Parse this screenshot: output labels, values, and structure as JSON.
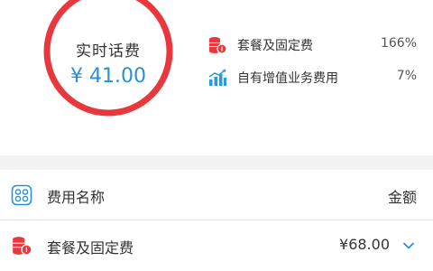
{
  "summary": {
    "title": "实时话费",
    "total": "¥ 41.00",
    "ring_colors": {
      "main": "#e8383d",
      "secondary": "#2a9be0"
    },
    "ring_shares": {
      "package_fixed": 0.95,
      "value_added": 0.05
    },
    "legend": [
      {
        "label": "套餐及固定费",
        "percent": "166%",
        "icon": "coin-stack-icon",
        "color": "#e8383d"
      },
      {
        "label": "自有增值业务费用",
        "percent": "7%",
        "icon": "bar-chart-icon",
        "color": "#2a9be0"
      }
    ]
  },
  "table": {
    "header": {
      "name": "费用名称",
      "amount": "金额",
      "icon": "fee-list-icon"
    },
    "rows": [
      {
        "name": "套餐及固定费",
        "amount": "¥68.00",
        "icon": "coin-stack-icon",
        "expand_icon": "chevron-down-icon"
      }
    ]
  },
  "colors": {
    "accent_blue": "#2a8fd8",
    "accent_red": "#e8383d",
    "divider": "#e6e6e6",
    "band": "#f2f2f2"
  }
}
